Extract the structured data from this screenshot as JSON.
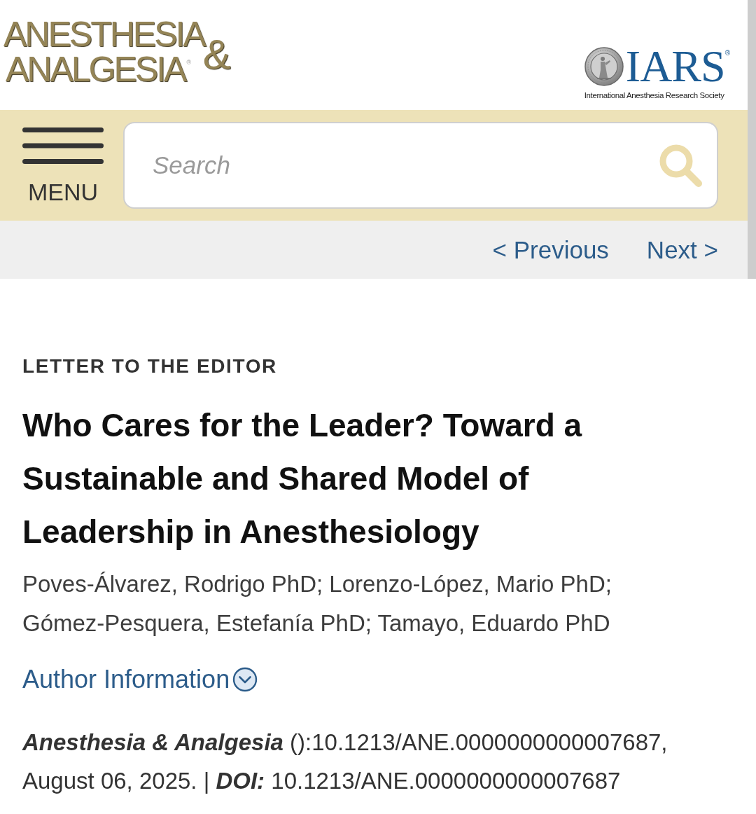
{
  "journal_logo": {
    "top_line": "ANESTHESIA",
    "bottom_line": "ANALGESIA",
    "registered": "®",
    "ampersand": "&"
  },
  "society_logo": {
    "acronym": "IARS",
    "registered": "®",
    "name": "International Anesthesia Research Society"
  },
  "toolbar": {
    "menu_label": "MENU",
    "search": {
      "placeholder": "Search"
    }
  },
  "pager": [
    {
      "label": "< Previous"
    },
    {
      "label": "Next >"
    }
  ],
  "article": {
    "type": "LETTER TO THE EDITOR",
    "title": "Who Cares for the Leader? Toward a Sustainable and Shared Model of Leadership in Anesthesiology",
    "authors": "Poves-Álvarez, Rodrigo PhD; Lorenzo-López, Mario PhD; Gómez-Pesquera, Estefanía PhD; Tamayo, Eduardo PhD",
    "author_info": {
      "label": "Author Information",
      "expanded": false
    },
    "citation": "*Anesthesia & Analgesia* ():10.1213/ANE.0000000000007687, August 06, 2025. | *DOI:* 10.1213/ANE.0000000000007687"
  }
}
